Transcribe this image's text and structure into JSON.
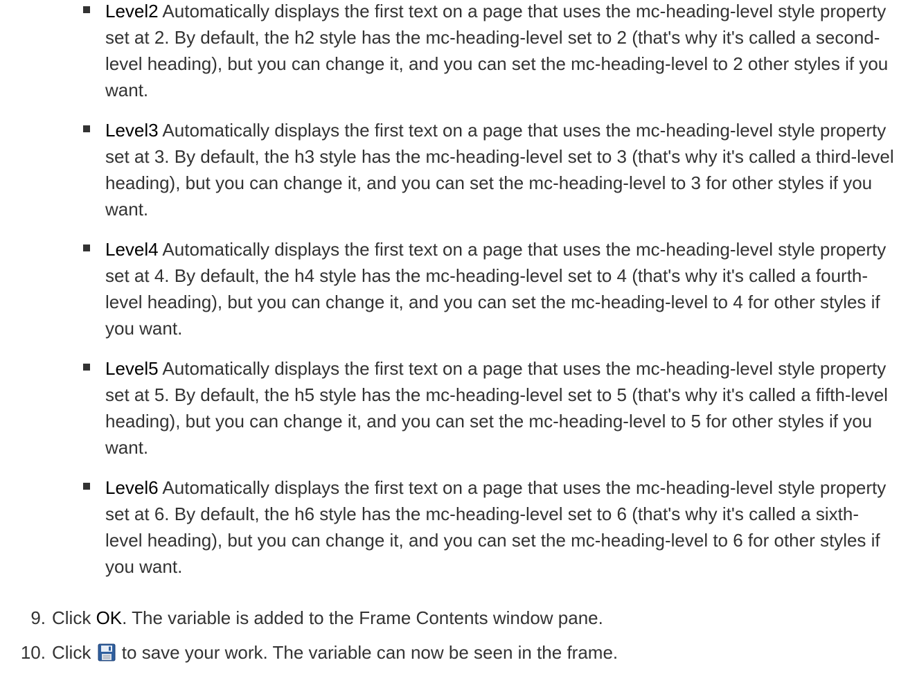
{
  "bullets": [
    {
      "term": "Level2",
      "text": " Automatically displays the first text on a page that uses the mc-heading-level style property set at 2. By default, the h2 style has the mc-heading-level set to 2 (that's why it's called a second-level heading), but you can change it, and you can set the mc-heading-level to 2 other styles if you want."
    },
    {
      "term": "Level3",
      "text": " Automatically displays the first text on a page that uses the mc-heading-level style property set at 3. By default, the h3 style has the mc-heading-level set to 3 (that's why it's called a third-level heading), but you can change it, and you can set the mc-heading-level to 3 for other styles if you want."
    },
    {
      "term": "Level4",
      "text": "  Automatically displays the first text on a page that uses the mc-heading-level style property set at 4. By default, the h4 style has the mc-heading-level set to 4 (that's why it's called a fourth-level heading), but you can change it, and you can set the mc-heading-level to 4 for other styles if you want."
    },
    {
      "term": "Level5",
      "text": "  Automatically displays the first text on a page that uses the mc-heading-level style property set at 5. By default, the h5 style has the mc-heading-level set to 5 (that's why it's called a fifth-level heading), but you can change it, and you can set the mc-heading-level to 5 for other styles if you want."
    },
    {
      "term": "Level6",
      "text": " Automatically displays the first text on a page that uses the mc-heading-level style property set at 6. By default, the h6 style has the mc-heading-level set to 6 (that's why it's called a sixth-level heading), but you can change it, and you can set the mc-heading-level to 6 for other styles if you want."
    }
  ],
  "steps": [
    {
      "number": "9.",
      "before": "Click ",
      "ui": "OK",
      "after": ". The variable is added to the Frame Contents window pane."
    },
    {
      "number": "10.",
      "before": "Click ",
      "icon": "save-icon",
      "after": " to save your work. The variable can now be seen in the frame."
    }
  ],
  "colors": {
    "text": "#333333",
    "emphasis": "#000000",
    "icon_blue": "#2f5f9e"
  }
}
